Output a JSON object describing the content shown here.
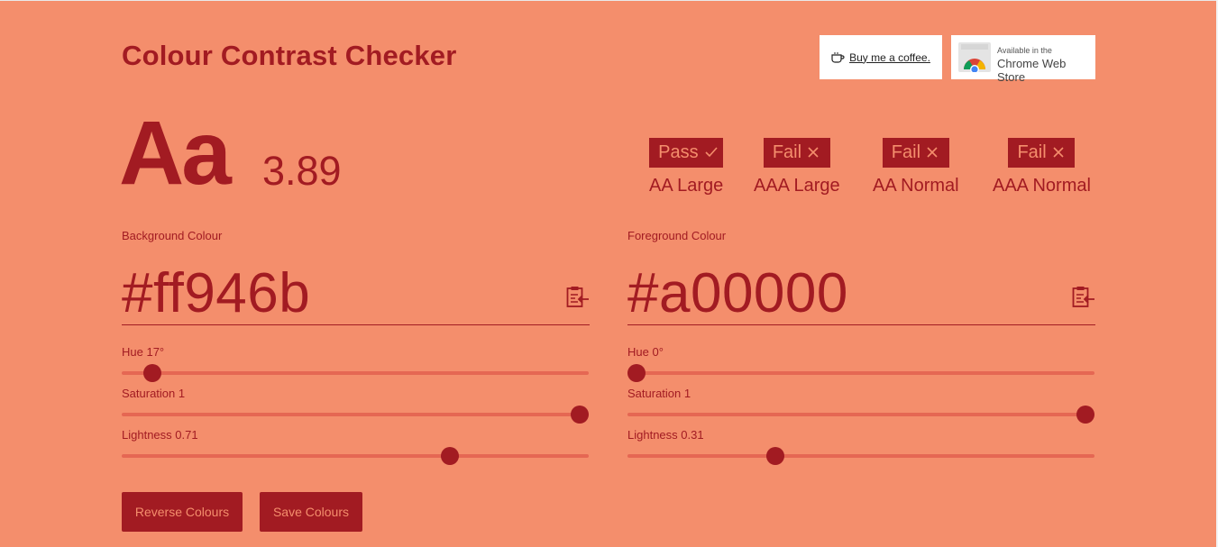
{
  "page": {
    "title": "Colour Contrast Checker"
  },
  "header": {
    "coffee_label": "Buy me a coffee.",
    "cws_line1": "Available in the",
    "cws_line2": "Chrome Web Store"
  },
  "preview": {
    "sample": "Aa",
    "ratio": "3.89"
  },
  "results": [
    {
      "status": "Pass",
      "level": "AA Large"
    },
    {
      "status": "Fail",
      "level": "AAA Large"
    },
    {
      "status": "Fail",
      "level": "AA Normal"
    },
    {
      "status": "Fail",
      "level": "AAA Normal"
    }
  ],
  "background": {
    "label": "Background Colour",
    "hex": "#ff946b",
    "hue_label": "Hue 17°",
    "hue": 17,
    "sat_label": "Saturation 1",
    "saturation": 1,
    "light_label": "Lightness 0.71",
    "lightness": 0.71
  },
  "foreground": {
    "label": "Foreground Colour",
    "hex": "#a00000",
    "hue_label": "Hue 0°",
    "hue": 0,
    "sat_label": "Saturation 1",
    "saturation": 1,
    "light_label": "Lightness 0.31",
    "lightness": 0.31
  },
  "buttons": {
    "reverse": "Reverse Colours",
    "save": "Save Colours"
  },
  "colors": {
    "background": "#f48e6c",
    "foreground": "#a21b22",
    "track": "#e56753"
  },
  "icons": {
    "pass": "check-icon",
    "fail": "cross-icon",
    "paste": "clipboard-paste-icon",
    "coffee": "coffee-cup-icon",
    "store": "chrome-logo-icon"
  }
}
